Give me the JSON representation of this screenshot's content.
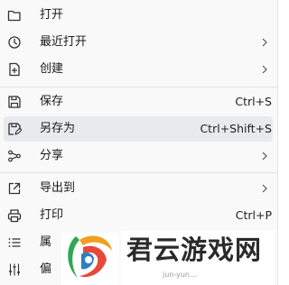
{
  "menu": {
    "items": [
      {
        "label": "打开",
        "icon": "folder-open-icon"
      },
      {
        "label": "最近打开",
        "icon": "clock-icon",
        "has_submenu": true
      },
      {
        "label": "创建",
        "icon": "add-document-icon",
        "has_submenu": true
      },
      {
        "label": "保存",
        "icon": "save-icon",
        "shortcut": "Ctrl+S"
      },
      {
        "label": "另存为",
        "icon": "save-as-icon",
        "shortcut": "Ctrl+Shift+S",
        "highlighted": true
      },
      {
        "label": "分享",
        "icon": "share-icon",
        "has_submenu": true
      },
      {
        "label": "导出到",
        "icon": "export-icon",
        "has_submenu": true
      },
      {
        "label": "打印",
        "icon": "printer-icon",
        "shortcut": "Ctrl+P"
      },
      {
        "label": "属",
        "icon": "list-icon"
      },
      {
        "label": "偏",
        "icon": "sliders-icon"
      }
    ],
    "hover_color": "#e9eaee"
  },
  "watermark": {
    "text": "君云游戏网",
    "subtext": "jun-yun..."
  }
}
